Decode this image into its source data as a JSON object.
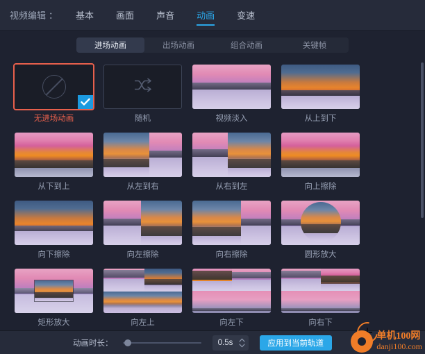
{
  "window": {
    "title": "视频编辑",
    "separator": "：",
    "tabs": [
      {
        "label": "基本",
        "active": false
      },
      {
        "label": "画面",
        "active": false
      },
      {
        "label": "声音",
        "active": false
      },
      {
        "label": "动画",
        "active": true
      },
      {
        "label": "变速",
        "active": false
      }
    ]
  },
  "subtabs": [
    {
      "label": "进场动画",
      "active": true
    },
    {
      "label": "出场动画",
      "active": false
    },
    {
      "label": "组合动画",
      "active": false
    },
    {
      "label": "关键帧",
      "active": false
    }
  ],
  "animations": [
    {
      "label": "无进场动画",
      "kind": "none",
      "selected": true
    },
    {
      "label": "随机",
      "kind": "random",
      "selected": false
    },
    {
      "label": "视频淡入",
      "kind": "fade",
      "selected": false
    },
    {
      "label": "从上到下",
      "kind": "top-down",
      "selected": false
    },
    {
      "label": "从下到上",
      "kind": "bottom-up",
      "selected": false
    },
    {
      "label": "从左到右",
      "kind": "left-right",
      "selected": false
    },
    {
      "label": "从右到左",
      "kind": "right-left",
      "selected": false
    },
    {
      "label": "向上擦除",
      "kind": "wipe-up",
      "selected": false
    },
    {
      "label": "向下擦除",
      "kind": "wipe-down",
      "selected": false
    },
    {
      "label": "向左擦除",
      "kind": "wipe-left",
      "selected": false
    },
    {
      "label": "向右擦除",
      "kind": "wipe-right",
      "selected": false
    },
    {
      "label": "圆形放大",
      "kind": "circle-zoom",
      "selected": false
    },
    {
      "label": "矩形放大",
      "kind": "rect-zoom",
      "selected": false
    },
    {
      "label": "向左上",
      "kind": "to-upper-left",
      "selected": false
    },
    {
      "label": "向左下",
      "kind": "to-lower-left",
      "selected": false
    },
    {
      "label": "向右下",
      "kind": "to-lower-right",
      "selected": false
    }
  ],
  "footer": {
    "duration_label": "动画时长：",
    "duration_value": "0.5s",
    "apply_label": "应用到当前轨道"
  },
  "watermark": {
    "line1": "单机100网",
    "line2": "danji100.com"
  },
  "icons": {
    "no_animation": "no-animation-icon",
    "random": "shuffle-icon",
    "check": "check-icon"
  },
  "colors": {
    "accent": "#2ba7e8",
    "selected_border": "#e8604c",
    "panel_bg": "#1e2230",
    "bar_bg": "#262b3a",
    "watermark": "#f07d28"
  }
}
